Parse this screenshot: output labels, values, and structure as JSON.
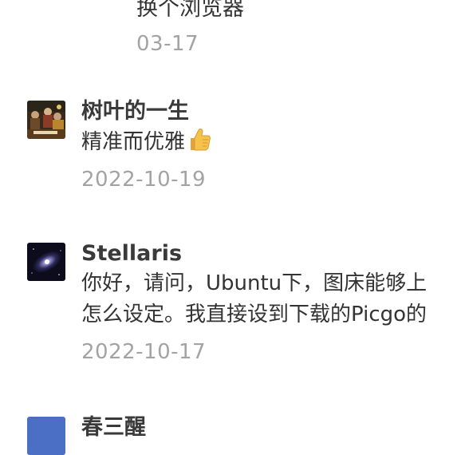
{
  "reply": {
    "text": "换个浏览器",
    "date": "03-17"
  },
  "comments": [
    {
      "author": "树叶的一生",
      "text": "精准而优雅",
      "emoji": "thumbs-up",
      "date": "2022-10-19"
    },
    {
      "author": "Stellaris",
      "lines": [
        "你好，请问，Ubuntu下，图床能够上",
        "怎么设定。我直接设到下载的Picgo的"
      ],
      "date": "2022-10-17"
    },
    {
      "author": "春三醒",
      "avatar_color": "#4a6fc4"
    }
  ],
  "colors": {
    "text": "#333333",
    "author": "#3a3a3a",
    "date": "#a3a3a3",
    "background": "#ffffff"
  }
}
